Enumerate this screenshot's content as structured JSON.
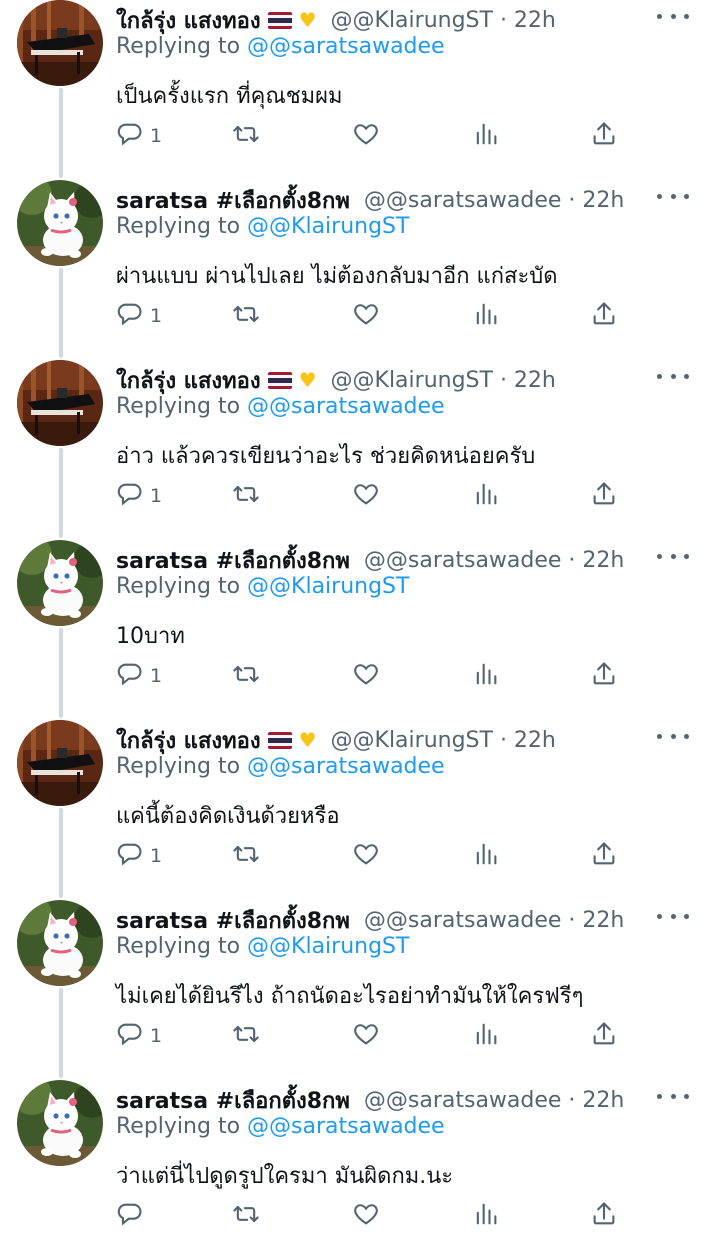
{
  "reply_prefix": "Replying to",
  "tweets": [
    {
      "name": "ใกล้รุ่ง แสงทอง",
      "has_flag": true,
      "handle": "@@KlairungST · 22h",
      "reply_to": "@@saratsawadee",
      "text": "เป็นครั้งแรก ที่คุณชมผม",
      "reply_count": "1",
      "avatar": "piano-avatar"
    },
    {
      "name": "saratsa #เลือกตั้ง8กพ",
      "has_flag": false,
      "handle": "@@saratsawadee · 22h",
      "reply_to": "@@KlairungST",
      "text": "ผ่านแบบ ผ่านไปเลย ไม่ต้องกลับมาอีก แก่สะบัด",
      "reply_count": "1",
      "avatar": "cat-avatar"
    },
    {
      "name": "ใกล้รุ่ง แสงทอง",
      "has_flag": true,
      "handle": "@@KlairungST · 22h",
      "reply_to": "@@saratsawadee",
      "text": "อ่าว แล้วควรเขียนว่าอะไร ช่วยคิดหน่อยครับ",
      "reply_count": "1",
      "avatar": "piano-avatar"
    },
    {
      "name": "saratsa #เลือกตั้ง8กพ",
      "has_flag": false,
      "handle": "@@saratsawadee · 22h",
      "reply_to": "@@KlairungST",
      "text": "10บาท",
      "reply_count": "1",
      "avatar": "cat-avatar"
    },
    {
      "name": "ใกล้รุ่ง แสงทอง",
      "has_flag": true,
      "handle": "@@KlairungST · 22h",
      "reply_to": "@@saratsawadee",
      "text": "แค่นี้ต้องคิดเงินด้วยหรือ",
      "reply_count": "1",
      "avatar": "piano-avatar"
    },
    {
      "name": "saratsa #เลือกตั้ง8กพ",
      "has_flag": false,
      "handle": "@@saratsawadee · 22h",
      "reply_to": "@@KlairungST",
      "text": "ไม่เคยได้ยินรึไง ถ้าถนัดอะไรอย่าทำมันให้ใครฟรีๆ",
      "reply_count": "1",
      "avatar": "cat-avatar"
    },
    {
      "name": "saratsa #เลือกตั้ง8กพ",
      "has_flag": false,
      "handle": "@@saratsawadee · 22h",
      "reply_to": "@@saratsawadee",
      "text": "ว่าแต่นี่ไปดูดรูปใครมา มันผิดกม.นะ",
      "reply_count": "",
      "avatar": "cat-avatar"
    }
  ],
  "colors": {
    "text": "#0f1419",
    "secondary": "#536471",
    "accent": "#1d9bf0",
    "thread_line": "#cfd9de"
  }
}
